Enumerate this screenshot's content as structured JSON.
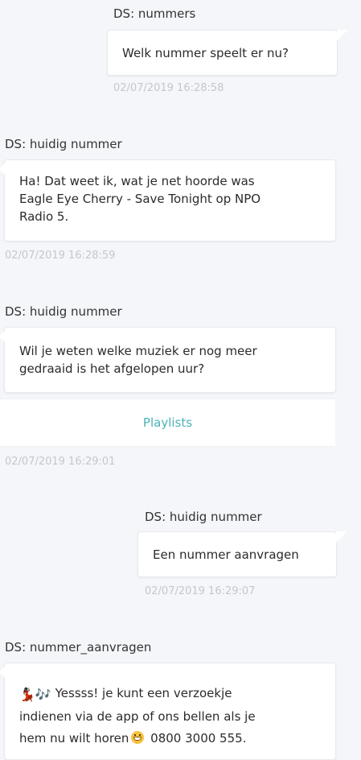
{
  "messages": [
    {
      "sender": "DS: nummers",
      "text": "Welk nummer speelt er nu?",
      "time": "02/07/2019 16:28:58"
    },
    {
      "sender": "DS: huidig nummer",
      "text": "Ha! Dat weet ik, wat je net hoorde was\nEagle Eye Cherry - Save Tonight op NPO\nRadio 5.",
      "time": "02/07/2019 16:28:59"
    },
    {
      "sender": "DS: huidig nummer",
      "text": "Wil je weten welke muziek er nog meer\ngedraaid is het afgelopen uur?",
      "quick_reply": "Playlists",
      "time": "02/07/2019 16:29:01"
    },
    {
      "sender": "DS: huidig nummer",
      "text": "Een nummer aanvragen",
      "time": "02/07/2019 16:29:07"
    },
    {
      "sender": "DS: nummer_aanvragen",
      "emoji_prefix": "💃🏿🎶",
      "text_line1": " Yessss! je kunt een verzoekje",
      "text_line2": "indienen via de app of ons bellen als je",
      "text_line3_before": "hem nu wilt horen",
      "emoji_grin": "grin-icon",
      "text_line3_after": " 0800 3000 555."
    }
  ],
  "colors": {
    "background": "#f4f6f9",
    "bubble": "#ffffff",
    "timestamp": "#c3c7cf",
    "quick_reply_text": "#4bb3b7"
  }
}
